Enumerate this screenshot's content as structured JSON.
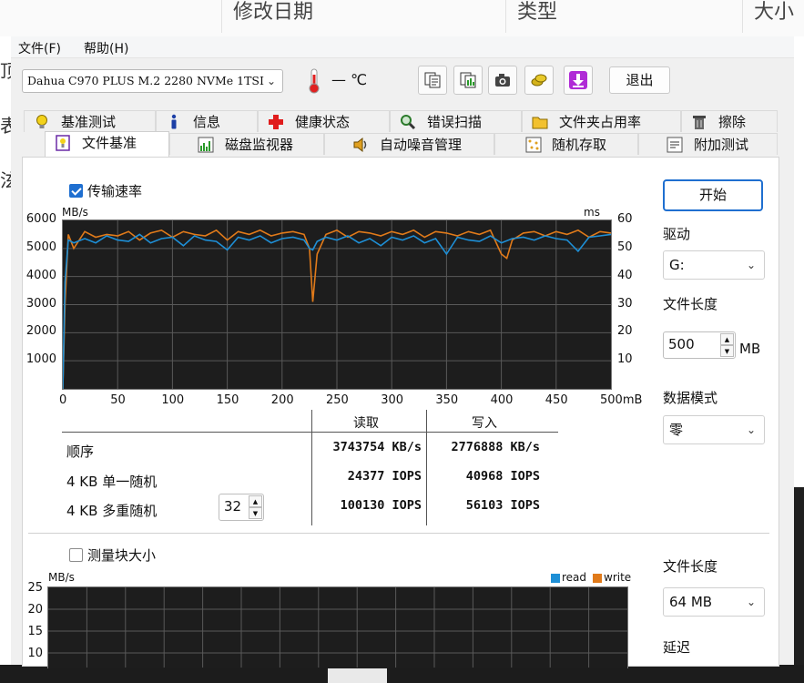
{
  "background": {
    "columns": [
      "修改日期",
      "类型",
      "大小"
    ],
    "left_glyphs": [
      "顶",
      "表",
      "泫"
    ]
  },
  "menu": {
    "file": "文件(F)",
    "help": "帮助(H)"
  },
  "toolbar": {
    "drive": "Dahua C970 PLUS M.2 2280 NVMe 1TSI",
    "temperature": "— ℃",
    "exit_label": "退出",
    "icons": [
      "copy-text-icon",
      "copy-image-icon",
      "camera-icon",
      "coins-icon",
      "download-icon"
    ]
  },
  "tabs_row1": [
    {
      "label": "基准测试",
      "icon": "lightbulb-icon"
    },
    {
      "label": "信息",
      "icon": "info-icon"
    },
    {
      "label": "健康状态",
      "icon": "health-cross-icon"
    },
    {
      "label": "错误扫描",
      "icon": "magnifier-icon"
    },
    {
      "label": "文件夹占用率",
      "icon": "folder-icon"
    },
    {
      "label": "擦除",
      "icon": "trash-icon"
    }
  ],
  "tabs_row2": [
    {
      "label": "文件基准",
      "icon": "file-benchmark-icon",
      "active": true
    },
    {
      "label": "磁盘监视器",
      "icon": "monitor-chart-icon"
    },
    {
      "label": "自动噪音管理",
      "icon": "speaker-icon"
    },
    {
      "label": "随机存取",
      "icon": "random-access-icon"
    },
    {
      "label": "附加测试",
      "icon": "extra-tests-icon"
    }
  ],
  "transfer": {
    "checkbox_label": "传输速率",
    "checked": true,
    "y_unit": "MB/s",
    "y2_unit": "ms",
    "x_unit": "500mB"
  },
  "results": {
    "col_read": "读取",
    "col_write": "写入",
    "rows": [
      {
        "label": "顺序",
        "read": "3743754 KB/s",
        "write": "2776888 KB/s"
      },
      {
        "label": "4 KB 单一随机",
        "read": "24377 IOPS",
        "write": "40968 IOPS"
      },
      {
        "label": "4 KB 多重随机",
        "read": "100130 IOPS",
        "write": "56103 IOPS"
      }
    ],
    "queue_depth": "32"
  },
  "side": {
    "start": "开始",
    "drive_label": "驱动",
    "drive_value": "G:",
    "length_label": "文件长度",
    "length_value": "500",
    "length_unit": "MB",
    "mode_label": "数据模式",
    "mode_value": "零"
  },
  "block": {
    "checkbox_label": "测量块大小",
    "checked": false,
    "y_unit": "MB/s",
    "legend_read": "read",
    "legend_write": "write",
    "length_label": "文件长度",
    "length_value": "64 MB",
    "delay_label": "延迟"
  },
  "colors": {
    "read": "#1e8fd6",
    "write": "#e07a1a",
    "grid": "#595959",
    "chart_bg": "#1d1d1d",
    "accent": "#1f6fd0"
  },
  "chart_data": [
    {
      "type": "line",
      "title": "",
      "ylabel": "MB/s",
      "y2label": "ms",
      "xlabel": "mB",
      "xlim": [
        0,
        500
      ],
      "ylim": [
        0,
        6000
      ],
      "y2lim": [
        0,
        60
      ],
      "x_ticks": [
        "0",
        "50",
        "100",
        "150",
        "200",
        "250",
        "300",
        "350",
        "400",
        "450",
        "500mB"
      ],
      "y_ticks": [
        "1000",
        "2000",
        "3000",
        "4000",
        "5000",
        "6000"
      ],
      "y2_ticks": [
        "10",
        "20",
        "30",
        "40",
        "50",
        "60"
      ],
      "series": [
        {
          "name": "read",
          "x": [
            0,
            2,
            5,
            10,
            20,
            30,
            40,
            50,
            60,
            70,
            80,
            90,
            100,
            110,
            120,
            130,
            140,
            150,
            160,
            170,
            180,
            190,
            200,
            210,
            220,
            225,
            228,
            232,
            240,
            250,
            260,
            270,
            280,
            290,
            300,
            310,
            320,
            330,
            340,
            350,
            360,
            370,
            380,
            390,
            400,
            410,
            420,
            430,
            440,
            450,
            460,
            470,
            480,
            490,
            500
          ],
          "y": [
            0,
            3800,
            5300,
            5200,
            5350,
            5200,
            5450,
            5300,
            5250,
            5500,
            5200,
            5350,
            5400,
            5100,
            5450,
            5300,
            5250,
            4950,
            5400,
            5300,
            5450,
            5200,
            5350,
            5400,
            5300,
            5000,
            4950,
            5250,
            5400,
            5300,
            5450,
            5200,
            5350,
            5100,
            5400,
            5300,
            5450,
            5200,
            5350,
            4800,
            5400,
            5300,
            5250,
            5450,
            5200,
            5350,
            5400,
            5300,
            5450,
            5350,
            5300,
            4900,
            5400,
            5450,
            5500
          ]
        },
        {
          "name": "write",
          "x": [
            0,
            2,
            5,
            10,
            20,
            30,
            40,
            50,
            60,
            70,
            80,
            90,
            100,
            110,
            120,
            130,
            140,
            150,
            160,
            170,
            180,
            190,
            200,
            210,
            220,
            225,
            228,
            232,
            240,
            250,
            260,
            270,
            280,
            290,
            300,
            310,
            320,
            330,
            340,
            350,
            360,
            370,
            380,
            390,
            400,
            405,
            410,
            420,
            430,
            440,
            450,
            460,
            470,
            480,
            490,
            500
          ],
          "y": [
            0,
            3000,
            5500,
            5000,
            5600,
            5400,
            5500,
            5450,
            5600,
            5300,
            5550,
            5650,
            5400,
            5600,
            5500,
            5450,
            5650,
            5300,
            5600,
            5500,
            5650,
            5450,
            5550,
            5600,
            5500,
            5000,
            3100,
            4800,
            5500,
            5650,
            5400,
            5600,
            5550,
            5450,
            5600,
            5500,
            5650,
            5400,
            5600,
            5550,
            5450,
            5600,
            5500,
            5650,
            4800,
            4650,
            5300,
            5550,
            5600,
            5450,
            5600,
            5500,
            5650,
            5400,
            5600,
            5550
          ]
        }
      ]
    },
    {
      "type": "line",
      "title": "",
      "ylabel": "MB/s",
      "y_ticks": [
        "10",
        "15",
        "20",
        "25"
      ],
      "series": [
        {
          "name": "read",
          "x": [],
          "y": []
        },
        {
          "name": "write",
          "x": [],
          "y": []
        }
      ]
    }
  ]
}
